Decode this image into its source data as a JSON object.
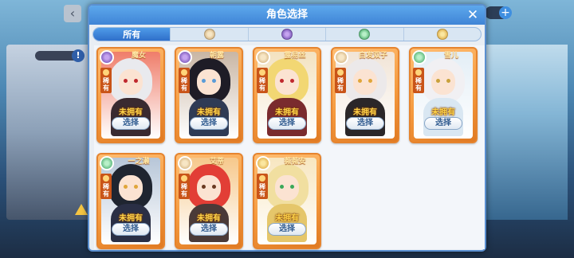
{
  "background": {
    "top_right_counter": "0",
    "top_right_plus": "+",
    "back_button": "‹",
    "info_icon": "!"
  },
  "dialog": {
    "title": "角色选择",
    "close_icon": "✕"
  },
  "filters": [
    {
      "label": "所有",
      "active": true,
      "icon": null
    },
    {
      "label": "",
      "active": false,
      "icon": "light-faction-icon"
    },
    {
      "label": "",
      "active": false,
      "icon": "dark-faction-icon"
    },
    {
      "label": "",
      "active": false,
      "icon": "wind-faction-icon"
    },
    {
      "label": "",
      "active": false,
      "icon": "gold-faction-icon"
    }
  ],
  "cards": [
    {
      "name": "魔女",
      "element": "dark",
      "rarity": "稀有",
      "status": "未拥有",
      "button": "选择",
      "hair": "#e9eaee",
      "clothes": "#3a2a30",
      "eyes": "#c0282e",
      "bg": "#ef7d6a"
    },
    {
      "name": "朝露",
      "element": "dark",
      "rarity": "稀有",
      "status": "未拥有",
      "button": "选择",
      "hair": "#1e1c26",
      "clothes": "#2f3b55",
      "eyes": "#5a9cd8",
      "bg": "#c9b6a4"
    },
    {
      "name": "露易丝",
      "element": "light",
      "rarity": "稀有",
      "status": "未拥有",
      "button": "选择",
      "hair": "#f2d773",
      "clothes": "#7a2b2e",
      "eyes": "#c0282e",
      "bg": "#f3e2c0"
    },
    {
      "name": "白发双子",
      "element": "light",
      "rarity": "稀有",
      "status": "未拥有",
      "button": "选择",
      "hair": "#ece9ea",
      "clothes": "#2b2729",
      "eyes": "#e0a63a",
      "bg": "#f1e4d6"
    },
    {
      "name": "雪儿",
      "element": "wind",
      "rarity": "稀有",
      "status": "未拥有",
      "button": "选择",
      "hair": "#f1f0f3",
      "clothes": "#d9e7f2",
      "eyes": "#c9a13a",
      "bg": "#e3eef6"
    },
    {
      "name": "一之濑",
      "element": "wind",
      "rarity": "稀有",
      "status": "未拥有",
      "button": "选择",
      "hair": "#1f2530",
      "clothes": "#2a2f45",
      "eyes": "#e0a63a",
      "bg": "#b7c6d8"
    },
    {
      "name": "艾蒂",
      "element": "light",
      "rarity": "稀有",
      "status": "未拥有",
      "button": "选择",
      "hair": "#e23e36",
      "clothes": "#4a3a38",
      "eyes": "#6a3a22",
      "bg": "#f6c88b"
    },
    {
      "name": "薇薇安",
      "element": "gold",
      "rarity": "稀有",
      "status": "未拥有",
      "button": "选择",
      "hair": "#f1dfa0",
      "clothes": "#e5c66a",
      "eyes": "#3aa85a",
      "bg": "#f7e6c0"
    }
  ],
  "colors": {
    "title_bar": "#3f84d6",
    "card_border": "#e6842e",
    "status_text": "#ffd54a"
  }
}
